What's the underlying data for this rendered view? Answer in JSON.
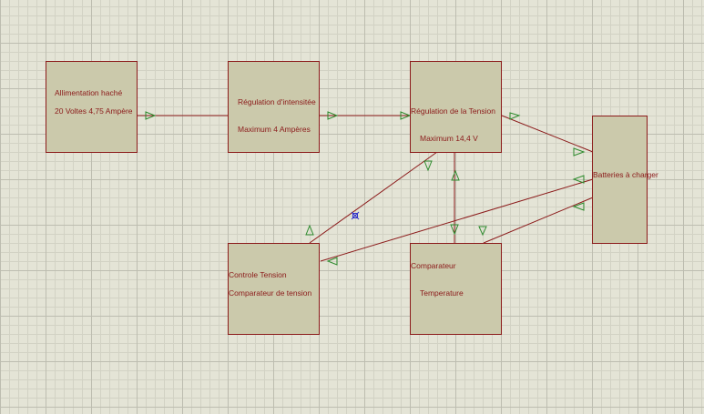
{
  "diagram": {
    "blocks": [
      {
        "id": "alimentation",
        "lines": [
          "Allimentation haché",
          "20 Voltes 4,75 Ampère"
        ]
      },
      {
        "id": "regulation-intensite",
        "lines": [
          "Régulation d'intensitée",
          "Maximum 4 Ampères"
        ]
      },
      {
        "id": "regulation-tension",
        "lines": [
          "Régulation de la Tension",
          "Maximum 14,4 V"
        ]
      },
      {
        "id": "batteries",
        "lines": [
          "Batteries à charger"
        ]
      },
      {
        "id": "controle-tension",
        "lines": [
          "Controle Tension",
          "Comparateur de tension"
        ]
      },
      {
        "id": "comparateur-temperature",
        "lines": [
          "Comparateur",
          "Temperature"
        ]
      }
    ]
  },
  "colors": {
    "wire": "#8b1a1a",
    "arrow": "#2e8b2e",
    "block_fill": "#cbc9ab",
    "grid_major": "#bdbdb0",
    "grid_minor": "#d2d2c4",
    "background": "#e4e4d6",
    "marker": "#3333cc"
  }
}
